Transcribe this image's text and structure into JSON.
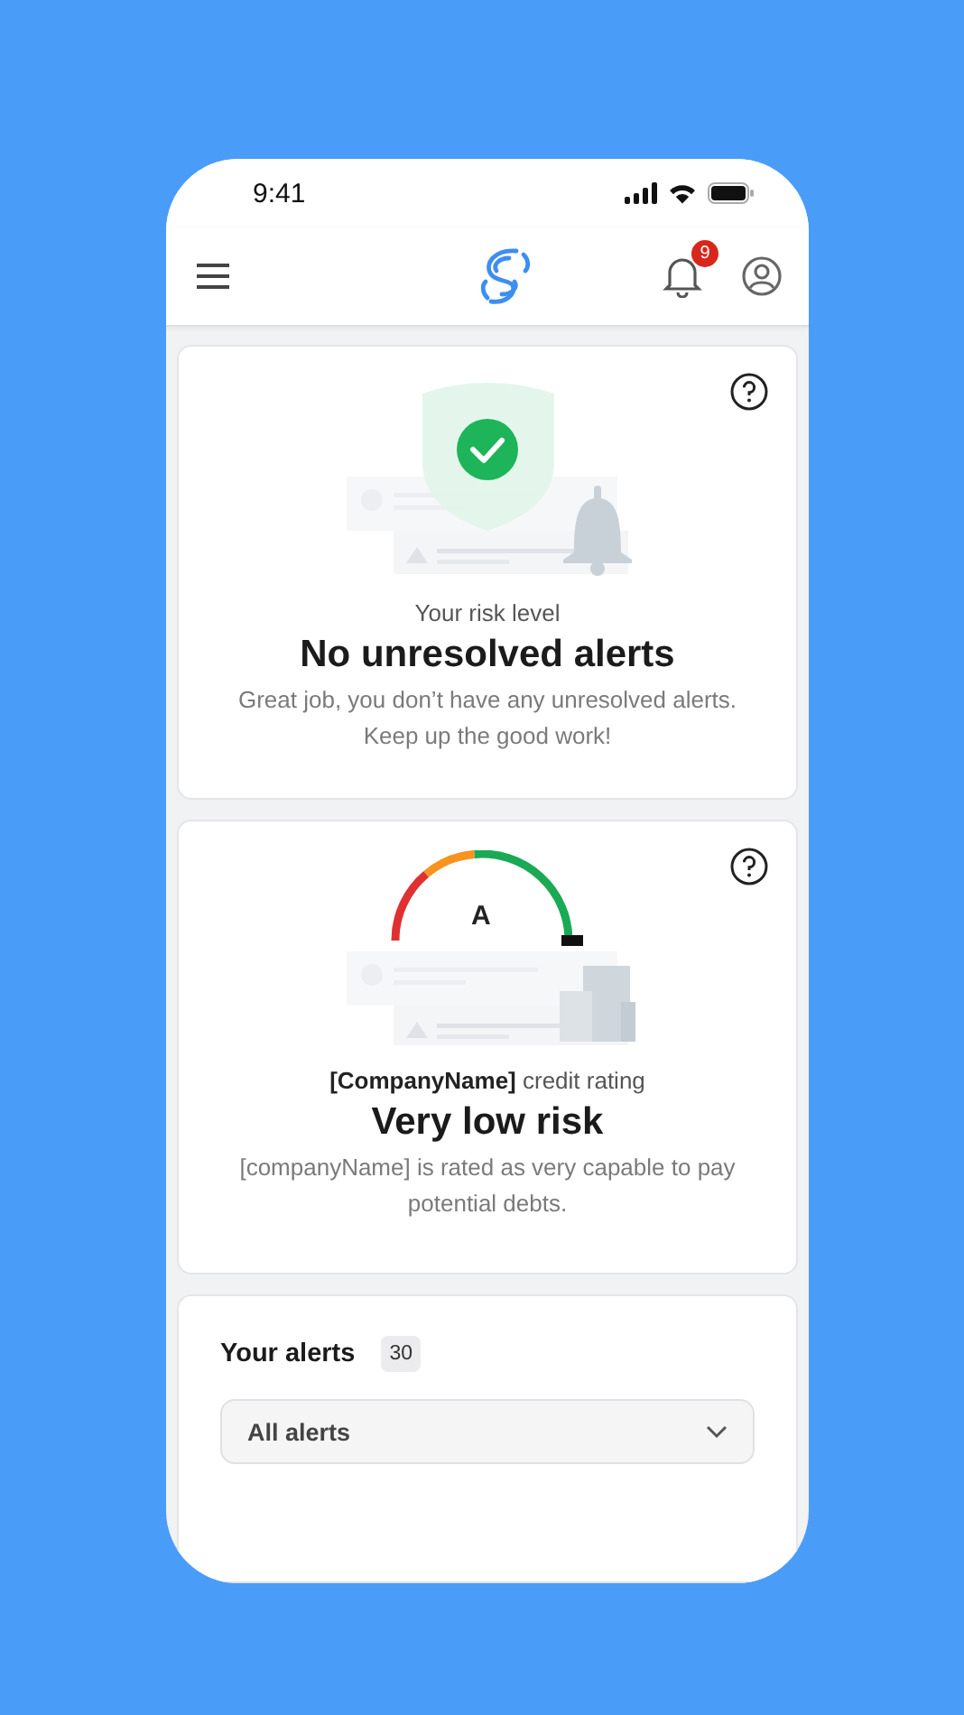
{
  "status_bar": {
    "time": "9:41"
  },
  "header": {
    "notification_count": "9"
  },
  "cards": [
    {
      "kind": "shield",
      "label": "Your risk level",
      "title": "No unresolved alerts",
      "description": "Great job, you don’t have any unresolved alerts. Keep up the good work!"
    },
    {
      "kind": "gauge",
      "grade": "A",
      "label": "**[CompanyName]** credit rating",
      "title": "Very low risk",
      "description": "[companyName] is rated as very capable to pay potential debts."
    }
  ],
  "alerts": {
    "title": "Your alerts",
    "count": "30",
    "filter": {
      "value": "All alerts"
    }
  }
}
